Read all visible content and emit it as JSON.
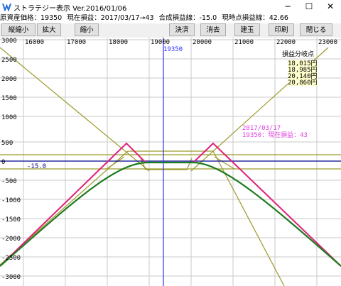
{
  "window": {
    "title": "ストラテジー表示 Ver.2016/01/06",
    "minimize": "─",
    "maximize": "☐",
    "close": "✕"
  },
  "info_bar": {
    "asset_price": "原資産価格：19350",
    "current_pl": "現在損益：2017/03/17→43",
    "combined_pl": "合成損益線：-15.0",
    "current_point_pl": "現時点損益線：42.66"
  },
  "toolbar": {
    "buttons": [
      "縦縮小",
      "拡大",
      "縮小",
      "決済",
      "消去",
      "建玉",
      "印刷",
      "閉じる"
    ]
  },
  "chart": {
    "x_ticks": [
      "16000",
      "17000",
      "18000",
      "19000",
      "20000",
      "21000",
      "22000",
      "23000"
    ],
    "y_ticks": [
      "3000",
      "2500",
      "2000",
      "1500",
      "1000",
      "500",
      "0",
      "-500",
      "-1000",
      "-1500",
      "-2000",
      "-2500",
      "-3000"
    ],
    "current_price_label": "19350",
    "zero_line_label": "-15.0",
    "breakeven_title": "損益分岐点",
    "breakeven_points": [
      "18,015円",
      "18,985円",
      "20,140円",
      "20,860円"
    ],
    "annotation_date": "2017/03/17",
    "annotation_value": "19350：現在損益：43",
    "colors": {
      "expiry_line": "#e0207a",
      "current_line": "#1e7a1e",
      "component_lines": "#9c9a2a",
      "price_line": "#3030ff",
      "zero_line": "#00008b",
      "annotation": "#e040e0",
      "breakeven_bg": "#ffffcc"
    }
  }
}
